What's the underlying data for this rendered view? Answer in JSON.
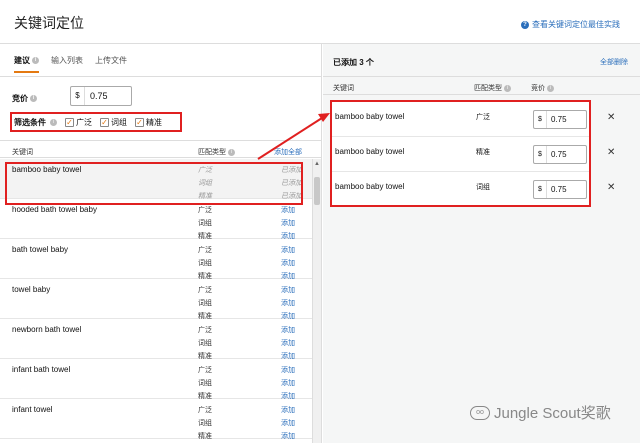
{
  "header": {
    "title": "关键词定位",
    "help_link": "查看关键词定位最佳实践",
    "help_icon": "?"
  },
  "left": {
    "tabs": [
      {
        "label": "建议",
        "active": true
      },
      {
        "label": "输入列表",
        "active": false
      },
      {
        "label": "上传文件",
        "active": false
      }
    ],
    "info_glyph": "i",
    "bid": {
      "label": "竞价",
      "currency": "$",
      "value": "0.75"
    },
    "filter": {
      "label": "筛选条件",
      "options": [
        {
          "label": "广泛",
          "checked": true
        },
        {
          "label": "词组",
          "checked": true
        },
        {
          "label": "精准",
          "checked": true
        }
      ]
    },
    "columns": {
      "keyword": "关键词",
      "match_type": "匹配类型",
      "add_all": "添加全部"
    },
    "rows": [
      {
        "keyword": "bamboo baby towel",
        "entries": [
          {
            "match": "广泛",
            "action": "已添加"
          },
          {
            "match": "词组",
            "action": "已添加"
          },
          {
            "match": "精准",
            "action": "已添加"
          }
        ],
        "added": true
      },
      {
        "keyword": "hooded bath towel baby",
        "entries": [
          {
            "match": "广泛",
            "action": "添加"
          },
          {
            "match": "词组",
            "action": "添加"
          },
          {
            "match": "精准",
            "action": "添加"
          }
        ],
        "added": false
      },
      {
        "keyword": "bath towel baby",
        "entries": [
          {
            "match": "广泛",
            "action": "添加"
          },
          {
            "match": "词组",
            "action": "添加"
          },
          {
            "match": "精准",
            "action": "添加"
          }
        ],
        "added": false
      },
      {
        "keyword": "towel baby",
        "entries": [
          {
            "match": "广泛",
            "action": "添加"
          },
          {
            "match": "词组",
            "action": "添加"
          },
          {
            "match": "精准",
            "action": "添加"
          }
        ],
        "added": false
      },
      {
        "keyword": "newborn bath towel",
        "entries": [
          {
            "match": "广泛",
            "action": "添加"
          },
          {
            "match": "词组",
            "action": "添加"
          },
          {
            "match": "精准",
            "action": "添加"
          }
        ],
        "added": false
      },
      {
        "keyword": "infant bath towel",
        "entries": [
          {
            "match": "广泛",
            "action": "添加"
          },
          {
            "match": "词组",
            "action": "添加"
          },
          {
            "match": "精准",
            "action": "添加"
          }
        ],
        "added": false
      },
      {
        "keyword": "infant towel",
        "entries": [
          {
            "match": "广泛",
            "action": "添加"
          },
          {
            "match": "词组",
            "action": "添加"
          },
          {
            "match": "精准",
            "action": "添加"
          }
        ],
        "added": false
      }
    ],
    "scroll_up_glyph": "▲"
  },
  "right": {
    "title": "已添加 3 个",
    "remove_all": "全部删除",
    "columns": {
      "keyword": "关键词",
      "match_type": "匹配类型",
      "bid": "竞价"
    },
    "rows": [
      {
        "keyword": "bamboo baby towel",
        "match": "广泛",
        "currency": "$",
        "bid": "0.75"
      },
      {
        "keyword": "bamboo baby towel",
        "match": "精准",
        "currency": "$",
        "bid": "0.75"
      },
      {
        "keyword": "bamboo baby towel",
        "match": "词组",
        "currency": "$",
        "bid": "0.75"
      }
    ],
    "remove_glyph": "✕"
  },
  "watermark": {
    "icon": "oo",
    "text": "Jungle Scout奖歌"
  },
  "colors": {
    "accent": "#e47911",
    "link": "#2a6ebb",
    "highlight": "#e02020"
  }
}
